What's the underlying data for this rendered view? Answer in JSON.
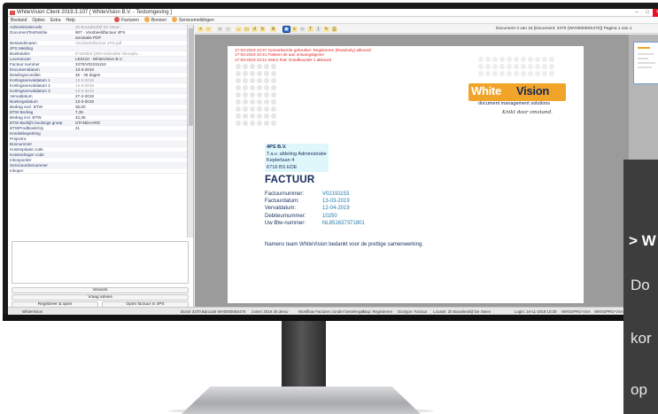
{
  "window": {
    "title": "WhiteVision Client 2019.3.107  [ WhiteVision B.V. - Testomgeving ]",
    "controls": [
      "–",
      "□",
      "✕"
    ]
  },
  "menu": {
    "items": [
      "Bestand",
      "Opties",
      "Extra",
      "Help"
    ],
    "tabs": [
      {
        "label": "Facturen",
        "color": "#d9534f"
      },
      {
        "label": "Bonnen",
        "color": "#f0ad4e"
      },
      {
        "label": "Servicemeldingen",
        "color": "#f0ad4e"
      }
    ]
  },
  "properties": [
    {
      "key": "Administratiecode",
      "value": "20 Bouwbedrijf De Steen",
      "muted": true
    },
    {
      "key": "DocumentTestNotitie",
      "value": "907 - Voorbeeldfactuur 4PS",
      "muted": false
    },
    {
      "key": "",
      "value": "annotatie PDF",
      "muted": false
    },
    {
      "key": "Bestandsnaam",
      "value": "Voorbeeldfactuur 4PS.pdf",
      "muted": true
    },
    {
      "key": "4PS Melding",
      "value": "",
      "muted": false
    },
    {
      "key": "Boekstuknr",
      "value": "IF100003 (300-Gebruikte inkoopfa...",
      "muted": true
    },
    {
      "key": "Leverancier",
      "value": "LE0210 - WhiteVision B.V.",
      "muted": false
    },
    {
      "key": "Factuur nummer",
      "value": "3470/V02191153",
      "muted": false
    },
    {
      "key": "Documentdatum",
      "value": "13-3-2019",
      "muted": false
    },
    {
      "key": "Betalingsconditie",
      "value": "45 - 45 dagen",
      "muted": false
    },
    {
      "key": "Kortingsvervaldatum 1",
      "value": "13-3-2019",
      "muted": true
    },
    {
      "key": "Kortingsvervaldatum 2",
      "value": "13-3-2019",
      "muted": true
    },
    {
      "key": "Kortingsvervaldatum 3",
      "value": "13-3-2019",
      "muted": true
    },
    {
      "key": "Vervaldatum",
      "value": "27-4-2019",
      "muted": false
    },
    {
      "key": "Boekingsdatum",
      "value": "13-3-2019",
      "muted": false
    },
    {
      "key": "Bedrag excl. BTW",
      "value": "35,00",
      "muted": false
    },
    {
      "key": "BTW Bedrag",
      "value": "7,35",
      "muted": false
    },
    {
      "key": "Bedrag incl. BTW",
      "value": "42,35",
      "muted": false
    },
    {
      "key": "BTW Bedrijfs bookings groep",
      "value": "STANDAARD",
      "muted": false
    },
    {
      "key": "BTWProdBoekGrp",
      "value": "21",
      "muted": false
    },
    {
      "key": "Kredietbeperking",
      "value": "",
      "muted": false
    },
    {
      "key": "Projectnr.",
      "value": "",
      "muted": false
    },
    {
      "key": "Bonnummer",
      "value": "",
      "muted": false
    },
    {
      "key": "Kostenplaats code",
      "value": "",
      "muted": false
    },
    {
      "key": "Kostendrager code",
      "value": "",
      "muted": false
    },
    {
      "key": "Inkooporder",
      "value": "",
      "muted": false
    },
    {
      "key": "Serviceordernummer",
      "value": "",
      "muted": false
    },
    {
      "key": "Inkoper",
      "value": "",
      "muted": false
    }
  ],
  "actions": {
    "verwerk": "Verwerk",
    "vraag_advies": "Vraag advies",
    "registreer_open": "Registreer & open",
    "open_factuur": "Open factuur in 4PS"
  },
  "viewer": {
    "docinfo": "Document 4 van 15  [Document: 3470 (WV000000S470)]  Pagina 1 van 1",
    "logs": [
      "17-03-2019 10:37 Gemarkeerde gebruiker: Registreren (Readonly) akkoord",
      "17-03-2019 10:41 Fiatteer de aan ontvangstgever",
      "17-03-2019 10:41 Intern Fiat: Goedkeurder 1 akkoord"
    ],
    "logo": {
      "white": "White",
      "vision": "Vision",
      "sub": "document management solutions",
      "slogan": "Knikt door omstand."
    },
    "address": [
      "4PS B.V.",
      "T.a.v. afdeling Administratie",
      "Keplerlaan 4",
      "6716 BS  EDE"
    ],
    "doc_title": "FACTUUR",
    "meta": [
      {
        "k": "Factuurnummer:",
        "v": "V02191153"
      },
      {
        "k": "Factuurdatum:",
        "v": "13-03-2019"
      },
      {
        "k": "Vervaldatum:",
        "v": "12-04-2019"
      },
      {
        "k": "Debiteurnummer:",
        "v": "10250"
      },
      {
        "k": "Uw Btw-nummer:",
        "v": "NL851637371801"
      }
    ],
    "thanks": "Namens team WhiteVision bedankt voor de prettige samenwerking."
  },
  "status": {
    "app": "WhiteVision",
    "doc": "Docnr 3470   Barcode WV000000S470",
    "zoom": "zomer 2019  36  demo",
    "workflow": "Workflow Facturen zonder bestelregel",
    "step": "Stap: Registreren",
    "type": "Doctype: Factuur",
    "loc": "Locatie: 20 Bouwbedrijf De Steen",
    "login": "Login: 16-11-2019 10:30",
    "user": "WIN\\GPRO-VSA",
    "user2": "WIN\\GPRO-VSA"
  },
  "overlay": {
    "heading": "> W",
    "lines": [
      "Do",
      "kor",
      "op"
    ]
  }
}
